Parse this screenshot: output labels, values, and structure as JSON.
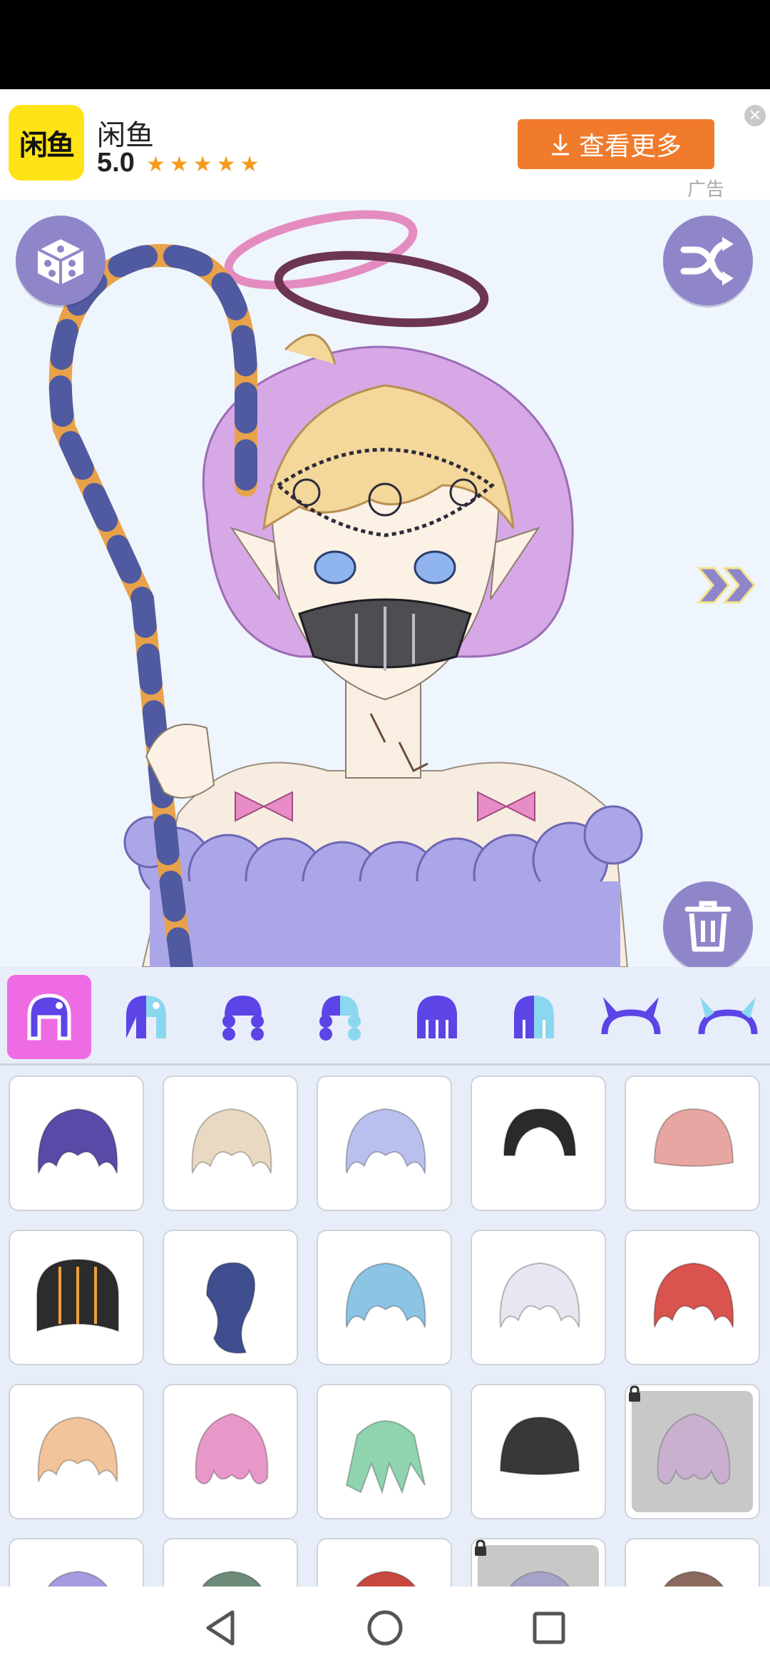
{
  "ad": {
    "app_name": "闲鱼",
    "logo_text": "闲鱼",
    "rating": "5.0",
    "stars": "★★★★★",
    "cta_label": "查看更多",
    "ad_tag": "广告"
  },
  "canvas": {
    "random_icon": "dice-icon",
    "shuffle_icon": "shuffle-icon",
    "next_icon": "double-chevron-right-icon",
    "delete_icon": "trash-icon"
  },
  "categories": [
    {
      "name": "hair-full",
      "active": true
    },
    {
      "name": "hair-full-alt"
    },
    {
      "name": "hair-braids"
    },
    {
      "name": "hair-braids-alt"
    },
    {
      "name": "hair-long"
    },
    {
      "name": "hair-long-alt"
    },
    {
      "name": "horns"
    },
    {
      "name": "horns-alt"
    }
  ],
  "hair_items": [
    {
      "color": "#5a4aa8",
      "style": "bob",
      "locked": false
    },
    {
      "color": "#ead9c2",
      "style": "bob",
      "locked": false
    },
    {
      "color": "#b9c0ee",
      "style": "bob",
      "locked": false
    },
    {
      "color": "#2a2a2a",
      "style": "slick",
      "locked": false
    },
    {
      "color": "#e8a6a2",
      "style": "bangs",
      "locked": false
    },
    {
      "color": "#2c2c2c",
      "style": "bangs-striped",
      "locked": false
    },
    {
      "color": "#3f4e8e",
      "style": "side",
      "locked": false
    },
    {
      "color": "#8cc4e4",
      "style": "bob",
      "locked": false
    },
    {
      "color": "#e8e6f0",
      "style": "bob",
      "locked": false
    },
    {
      "color": "#d9534f",
      "style": "bob",
      "locked": false
    },
    {
      "color": "#f2c49c",
      "style": "bob",
      "locked": false
    },
    {
      "color": "#e898c8",
      "style": "curly",
      "locked": false
    },
    {
      "color": "#8fd4ae",
      "style": "spiky",
      "locked": false
    },
    {
      "color": "#383838",
      "style": "bangs",
      "locked": false
    },
    {
      "color": "#c8a8d0",
      "style": "curly",
      "locked": true
    },
    {
      "color": "#a89ae0",
      "style": "bob",
      "locked": false
    },
    {
      "color": "#6e8a78",
      "style": "bob",
      "locked": false
    },
    {
      "color": "#c8483e",
      "style": "bob",
      "locked": false
    },
    {
      "color": "#9a98c8",
      "style": "bob",
      "locked": true
    },
    {
      "color": "#8a6a5e",
      "style": "bob",
      "locked": false
    }
  ],
  "nav": {
    "back_icon": "back-triangle-icon",
    "home_icon": "home-circle-icon",
    "recents_icon": "recents-square-icon"
  }
}
